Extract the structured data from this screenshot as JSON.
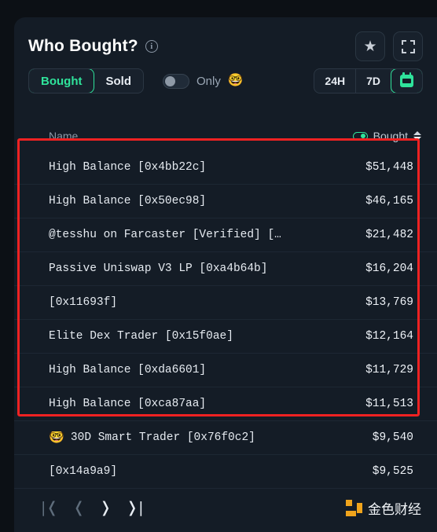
{
  "header": {
    "title": "Who Bought?",
    "info_icon": "info-icon",
    "star_icon": "★",
    "expand_icon": "expand-icon"
  },
  "controls": {
    "side_options": [
      {
        "label": "Bought",
        "selected": true
      },
      {
        "label": "Sold",
        "selected": false
      }
    ],
    "only_toggle": {
      "label": "Only",
      "emoji": "🤓",
      "on": false
    },
    "range_options": [
      {
        "label": "24H",
        "selected": false
      },
      {
        "label": "7D",
        "selected": false
      },
      {
        "label": "",
        "icon": "calendar-icon",
        "selected": true
      }
    ]
  },
  "table": {
    "columns": {
      "name": "Name",
      "value": "Bought"
    },
    "sort_icon": "sort-arrows-icon",
    "value_toggle_icon": "green-toggle-icon",
    "rows": [
      {
        "emoji": "",
        "name": "High Balance [0x4bb22c]",
        "value": "$51,448",
        "highlighted": true
      },
      {
        "emoji": "",
        "name": "High Balance [0x50ec98]",
        "value": "$46,165",
        "highlighted": true
      },
      {
        "emoji": "",
        "name": "@tesshu on Farcaster [Verified] […",
        "value": "$21,482",
        "highlighted": true
      },
      {
        "emoji": "",
        "name": "Passive Uniswap V3 LP [0xa4b64b]",
        "value": "$16,204",
        "highlighted": true
      },
      {
        "emoji": "",
        "name": "[0x11693f]",
        "value": "$13,769",
        "highlighted": true
      },
      {
        "emoji": "",
        "name": "Elite Dex Trader [0x15f0ae]",
        "value": "$12,164",
        "highlighted": true
      },
      {
        "emoji": "",
        "name": "High Balance [0xda6601]",
        "value": "$11,729",
        "highlighted": true
      },
      {
        "emoji": "",
        "name": "High Balance [0xca87aa]",
        "value": "$11,513",
        "highlighted": true
      },
      {
        "emoji": "🤓",
        "name": "30D Smart Trader [0x76f0c2]",
        "value": "$9,540",
        "highlighted": false
      },
      {
        "emoji": "",
        "name": "[0x14a9a9]",
        "value": "$9,525",
        "highlighted": false
      }
    ]
  },
  "footer": {
    "pagination": [
      {
        "glyph": "|❬",
        "name": "first-page-button",
        "disabled": true
      },
      {
        "glyph": "❬",
        "name": "prev-page-button",
        "disabled": true
      },
      {
        "glyph": "❭",
        "name": "next-page-button",
        "disabled": false
      },
      {
        "glyph": "❭|",
        "name": "last-page-button",
        "disabled": false
      }
    ],
    "brand_text": "金色财经"
  },
  "colors": {
    "accent_green": "#2fe39b",
    "card_bg": "#141c26",
    "page_bg": "#0c1015",
    "annotation_red": "#f02222",
    "brand_orange": "#f0a41c"
  }
}
